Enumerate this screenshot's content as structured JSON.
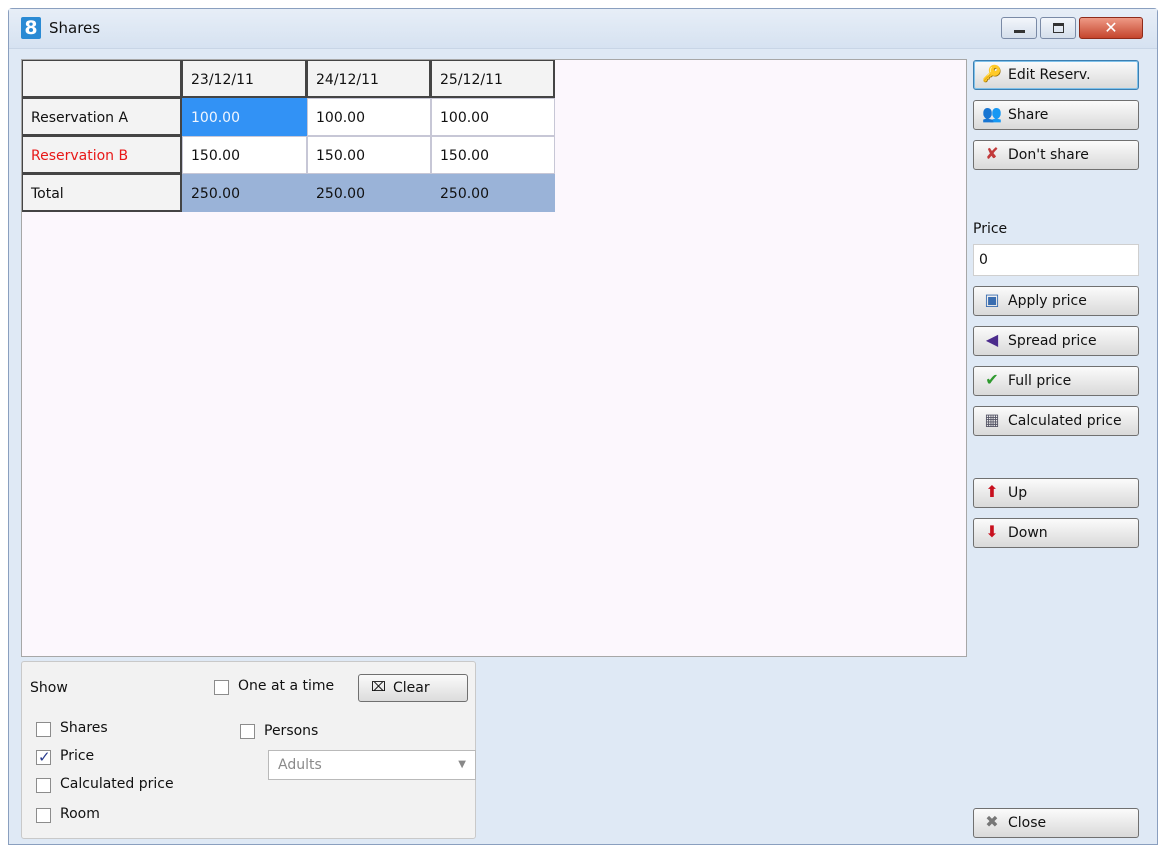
{
  "window": {
    "title": "Shares",
    "app_icon_text": "8"
  },
  "grid": {
    "columns": [
      "23/12/11",
      "24/12/11",
      "25/12/11"
    ],
    "rows": [
      {
        "label": "Reservation A",
        "values": [
          "100.00",
          "100.00",
          "100.00"
        ],
        "label_color": "#111111"
      },
      {
        "label": "Reservation B",
        "values": [
          "150.00",
          "150.00",
          "150.00"
        ],
        "label_color": "#e81818"
      },
      {
        "label": "Total",
        "values": [
          "250.00",
          "250.00",
          "250.00"
        ],
        "label_color": "#111111"
      }
    ]
  },
  "options": {
    "show_label": "Show",
    "one_at_a_time_label": "One at a time",
    "one_at_a_time_checked": false,
    "clear_label": "Clear",
    "shares_label": "Shares",
    "shares_checked": false,
    "price_label": "Price",
    "price_checked": true,
    "calculated_price_label": "Calculated price",
    "calculated_price_checked": false,
    "room_label": "Room",
    "room_checked": false,
    "persons_label": "Persons",
    "persons_checked": false,
    "persons_type_value": "Adults"
  },
  "sidebar": {
    "edit_reserv_label": "Edit Reserv.",
    "share_label": "Share",
    "dont_share_label": "Don't share",
    "price_label": "Price",
    "price_value": "0",
    "apply_price_label": "Apply price",
    "spread_price_label": "Spread price",
    "full_price_label": "Full price",
    "calculated_price_label": "Calculated price",
    "up_label": "Up",
    "down_label": "Down",
    "close_label": "Close"
  },
  "colors": {
    "selected_cell": "#3292f5",
    "total_row": "#9ab3d8",
    "reservation_b_label": "#e81818"
  }
}
